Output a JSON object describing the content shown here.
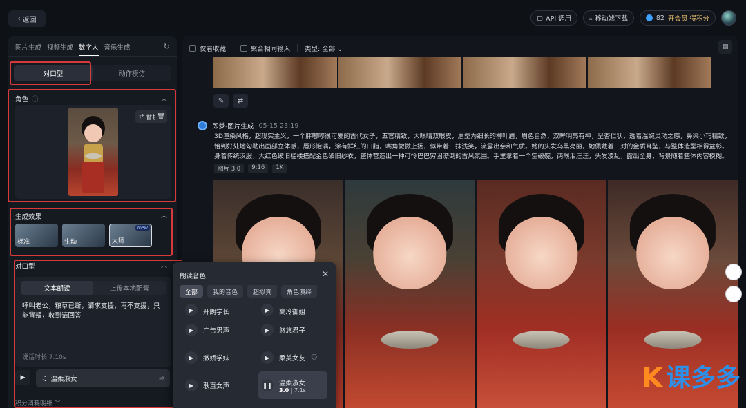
{
  "topbar": {
    "back_label": "返回",
    "api_label": "API 调用",
    "mobile_label": "移动端下载",
    "credits": "82",
    "vip_label": "开会员 得积分"
  },
  "left": {
    "mode_tabs": [
      "图片生成",
      "视频生成",
      "数字人",
      "音乐生成"
    ],
    "sub_tabs": [
      "对口型",
      "动作模仿"
    ],
    "role_title": "角色",
    "replace_label": "替换",
    "effects_title": "生成效果",
    "effects": [
      {
        "label": "标准"
      },
      {
        "label": "生动"
      },
      {
        "label": "大师",
        "badge": "New"
      }
    ],
    "lip_title": "对口型",
    "lip_tabs": [
      "文本朗读",
      "上传本地配音"
    ],
    "lip_text": "呼叫老公，粮草已断，请求支援，再不支援，只能背叛，收到请回答",
    "lip_duration": "说话时长 7.10s",
    "voice_name": "温柔淑女",
    "cost_label": "积分消耗明细"
  },
  "main": {
    "filters": [
      "仅看收藏",
      "聚合相同输入"
    ],
    "type_label": "类型: 全部",
    "gen_author": "即梦-图片生成",
    "gen_time": "05-15   23:19",
    "gen_desc": "3D渲染风格，超现实主义，一个胖嘟嘟很可爱的古代女子，五官精致，大眼睛双眼皮，眉型为细长的柳叶眉，眉色自然，双眸明亮有神，呈杏仁状，透着温婉灵动之感，鼻梁小巧精致，恰到好处地勾勒出面部立体感，唇形饱满，涂有鲜红的口脂，嘴角微微上扬，似带着一抹浅笑，流露出亲和气质。她的头发乌黑亮丽，她佩戴着一对的金质耳坠，与整体造型相得益彰。身着传统汉服，大红色破旧褴褛搭配金色破旧纱衣，整体营造出一种可怜巴巴穷困潦倒的古风氛围。手里拿着一个空破碗，两眼泪汪汪，头发凌乱，露出全身，背景随着整体内容模糊。",
    "gen_tags": [
      "图片 3.0",
      "9:16",
      "1K"
    ]
  },
  "popup": {
    "title": "朗读音色",
    "filters": [
      "全部",
      "我的音色",
      "超拟真",
      "角色演绎"
    ],
    "voices": [
      {
        "name": "开朗学长",
        "cut": true
      },
      {
        "name": "高冷御姐",
        "cut": true
      },
      {
        "name": "广告男声"
      },
      {
        "name": "悠悠君子"
      },
      {
        "name": "撒娇学妹"
      },
      {
        "name": "柔美女友"
      },
      {
        "name": "耿直女声"
      },
      {
        "name": "温柔淑女",
        "version": "3.0",
        "duration": "7.1s",
        "selected": true
      }
    ]
  },
  "watermark": {
    "k": "K",
    "text": "课多多"
  }
}
